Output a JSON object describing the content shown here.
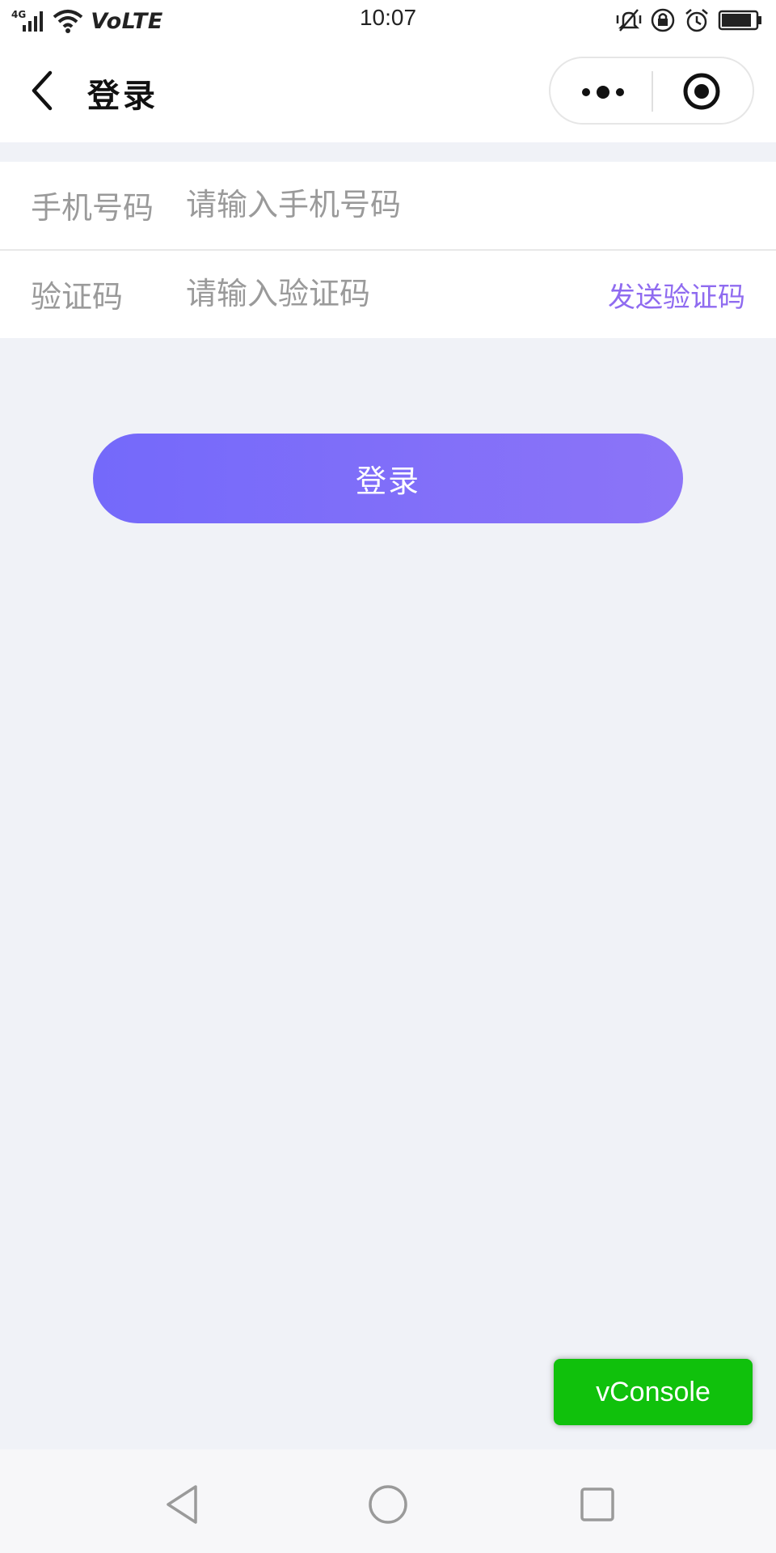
{
  "status_bar": {
    "network": "4G",
    "volte": "VoLTE",
    "time": "10:07",
    "icons": [
      "signal-icon",
      "wifi-icon",
      "mute-icon",
      "screen-lock-icon",
      "alarm-icon",
      "battery-icon"
    ]
  },
  "nav": {
    "title": "登录"
  },
  "form": {
    "phone": {
      "label": "手机号码",
      "placeholder": "请输入手机号码",
      "value": ""
    },
    "code": {
      "label": "验证码",
      "placeholder": "请输入验证码",
      "value": "",
      "send_label": "发送验证码"
    }
  },
  "login_button": "登录",
  "vconsole_button": "vConsole",
  "colors": {
    "accent": "#8f6bf0",
    "button_start": "#7469fa",
    "button_end": "#8c74f8",
    "vconsole": "#10c10c",
    "background": "#f0f2f7"
  }
}
